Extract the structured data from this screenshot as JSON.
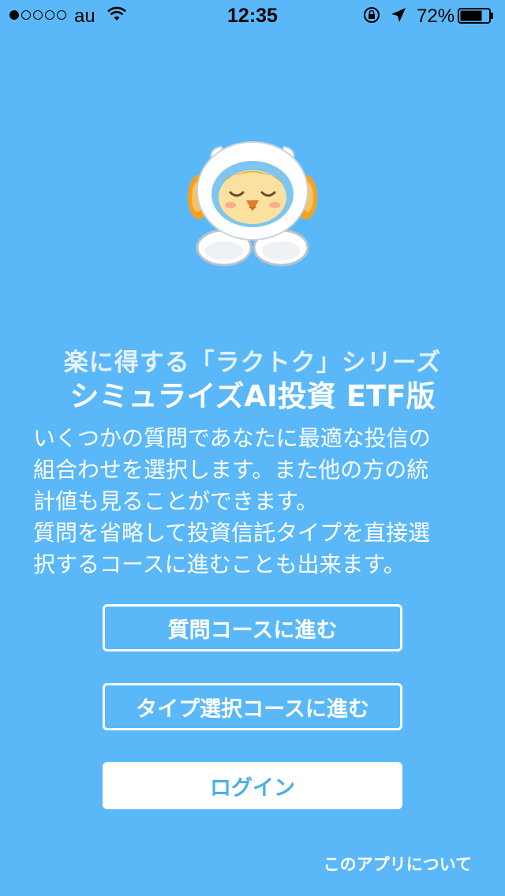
{
  "status_bar": {
    "carrier": "au",
    "time": "12:35",
    "battery_percent": "72%",
    "signal_bars_filled": 1,
    "signal_bars_total": 5
  },
  "mascot": {
    "icon": "owl-mascot-with-headphones"
  },
  "series_title": "楽に得する「ラクトク」シリーズ",
  "app_title": "シミュライズAI投資 ETF版",
  "description": "いくつかの質問であなたに最適な投信の\n組合わせを選択します。また他の方の統\n計値も見ることができます。\n質問を省略して投資信託タイプを直接選\n択するコースに進むことも出来ます。",
  "buttons": {
    "question_course": "質問コースに進む",
    "type_select_course": "タイプ選択コースに進む",
    "login": "ログイン"
  },
  "about_link": "このアプリについて",
  "colors": {
    "background": "#5ab8f8",
    "login_text": "#4aaee8",
    "mascot_orange": "#f6a11e"
  }
}
